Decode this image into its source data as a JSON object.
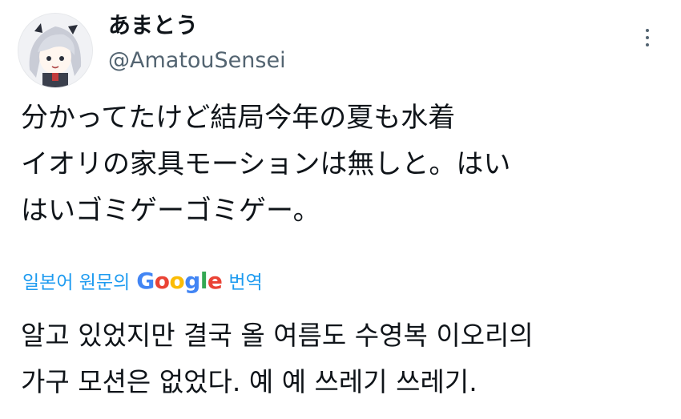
{
  "author": {
    "display_name": "あまとう",
    "handle": "@AmatouSensei"
  },
  "tweet": {
    "lines": [
      "分かってたけど結局今年の夏も水着",
      "イオリの家具モーションは無しと。はい",
      "はいゴミゲーゴミゲー。"
    ]
  },
  "translation": {
    "label_prefix": "일본어 원문의",
    "google_letters": [
      "G",
      "o",
      "o",
      "g",
      "l",
      "e"
    ],
    "label_suffix": "번역",
    "lines": [
      "알고 있었지만 결국 올 여름도 수영복 이오리의",
      "가구 모션은 없었다. 예 예 쓰레기 쓰레기."
    ]
  },
  "icons": {
    "more": "more-vertical-icon",
    "avatar": "anime-girl-avatar"
  },
  "colors": {
    "link": "#1d9bf0",
    "secondary_text": "#536471",
    "google_blue": "#4285f4",
    "google_red": "#ea4335",
    "google_yellow": "#fbbc05",
    "google_green": "#34a853"
  }
}
